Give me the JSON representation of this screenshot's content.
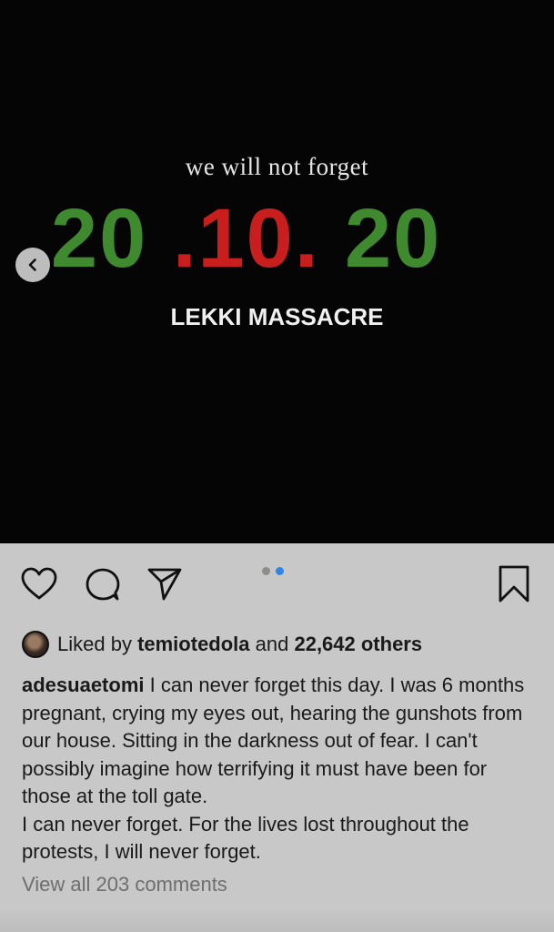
{
  "post_image": {
    "tagline": "we will not forget",
    "date_parts": [
      {
        "text": "20",
        "color": "#3f8a2f"
      },
      {
        "text": " .",
        "color": "#c81e1e"
      },
      {
        "text": "10",
        "color": "#c81e1e"
      },
      {
        "text": ". ",
        "color": "#c81e1e"
      },
      {
        "text": "20",
        "color": "#3f8a2f"
      }
    ],
    "subtitle": "LEKKI MASSACRE",
    "prev_icon": "chevron-left-icon"
  },
  "actions": {
    "like_icon": "heart-icon",
    "comment_icon": "comment-icon",
    "share_icon": "send-icon",
    "save_icon": "bookmark-icon",
    "carousel_page": 2,
    "carousel_total": 2
  },
  "likes": {
    "prefix": "Liked by ",
    "user": "temiotedola",
    "middle": " and ",
    "others": "22,642 others"
  },
  "caption": {
    "username": "adesuaetomi",
    "text1": " I can never forget this day. I was 6 months pregnant, crying my eyes out, hearing the gunshots from our house. Sitting in the darkness out of fear. I can't possibly imagine how terrifying it must have been for those at the toll gate.",
    "text2": "I can never forget. For the lives lost throughout the protests, I will never forget."
  },
  "comments": {
    "view_all": "View all 203 comments"
  },
  "colors": {
    "accent_blue": "#2f86e8",
    "green": "#3f8a2f",
    "red": "#c81e1e"
  }
}
